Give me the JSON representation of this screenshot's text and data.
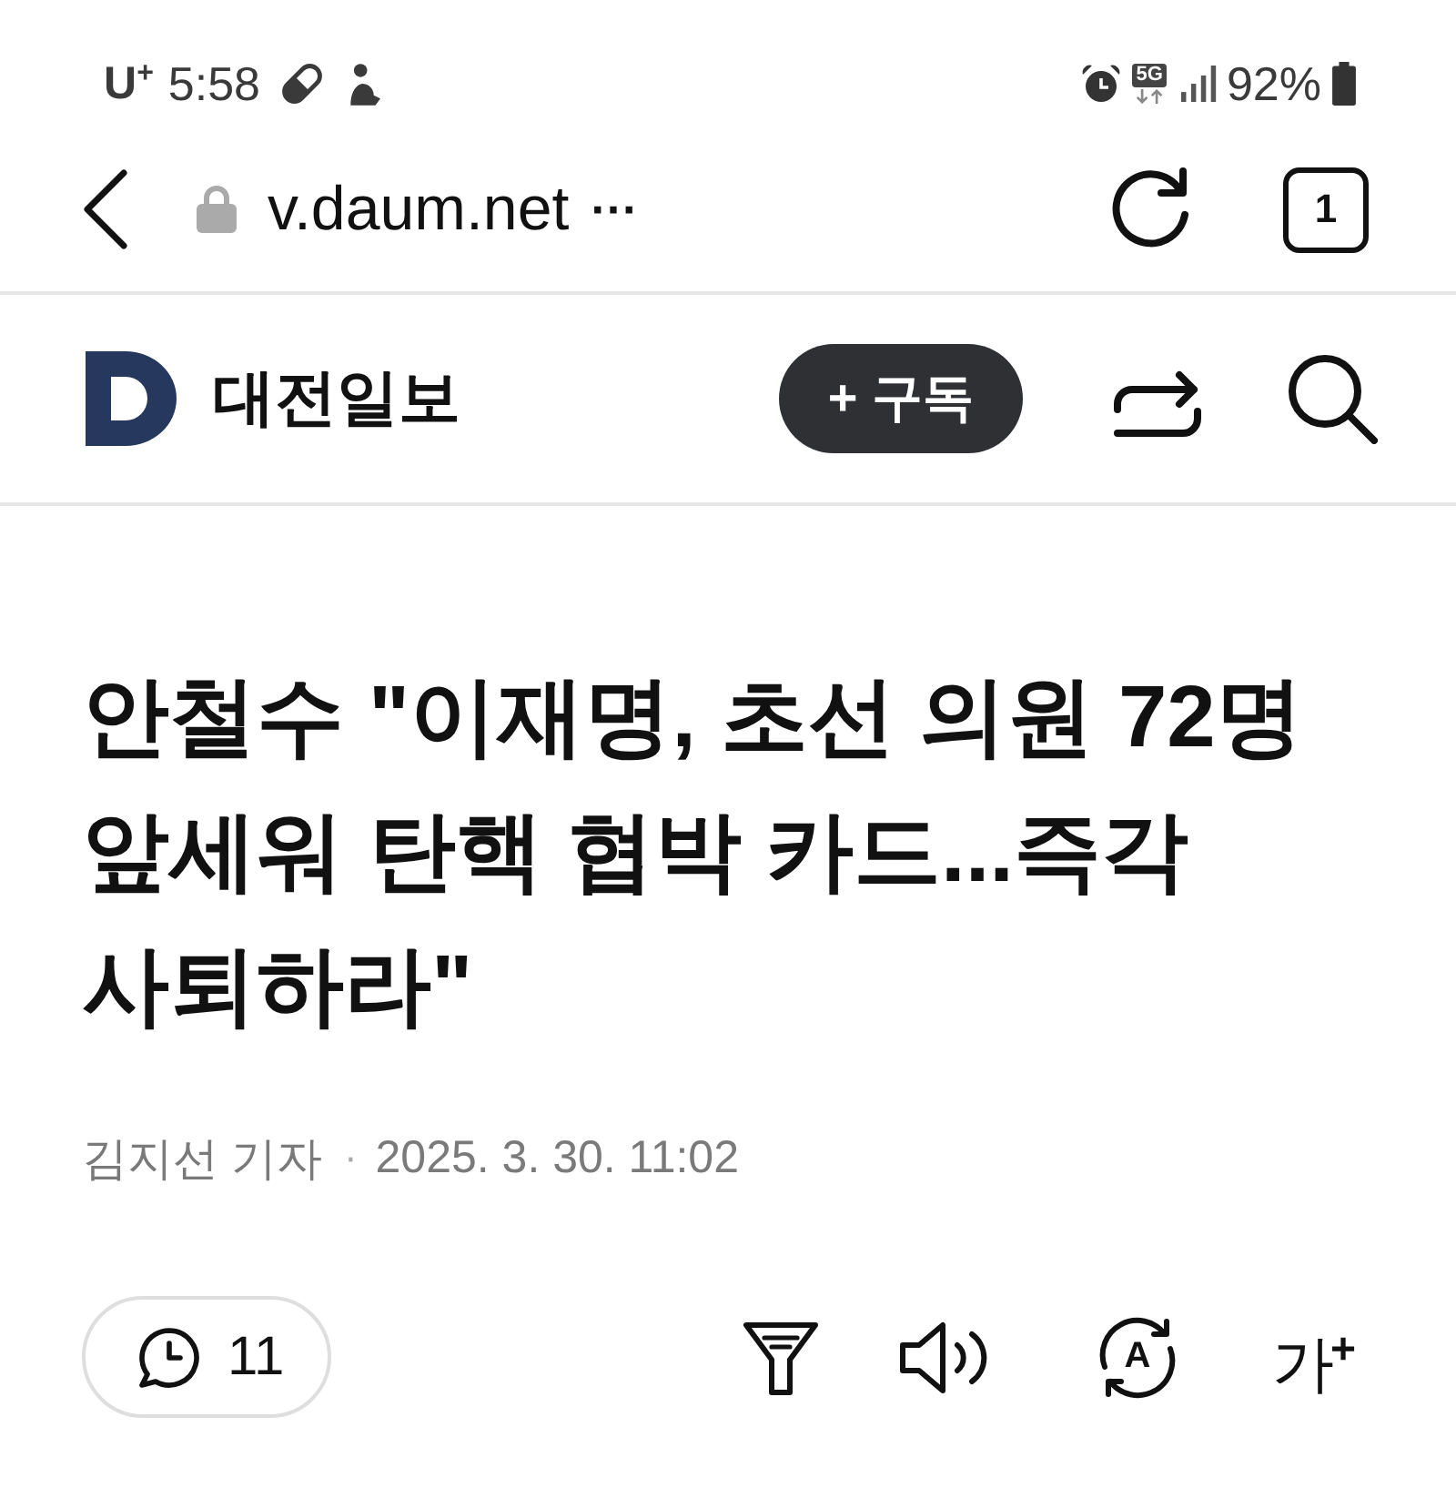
{
  "status_bar": {
    "carrier": "U$^{+}$",
    "time": "5:58",
    "network": "5G",
    "battery": "92%"
  },
  "address_bar": {
    "url": "v.daum.net",
    "more": "···",
    "tab_count": "1"
  },
  "header": {
    "publisher": "대전일보",
    "subscribe": "+ 구독"
  },
  "article": {
    "title": "안철수 \"이재명, 초선 의원 72명 앞세워 탄핵 협박 카드...즉각 사퇴하라\"",
    "author": "김지선 기자",
    "separator": "·",
    "date": "2025. 3. 30. 11:02"
  },
  "toolbar": {
    "comments": "11",
    "translate": "A",
    "font_size": "가$^{+}$"
  }
}
